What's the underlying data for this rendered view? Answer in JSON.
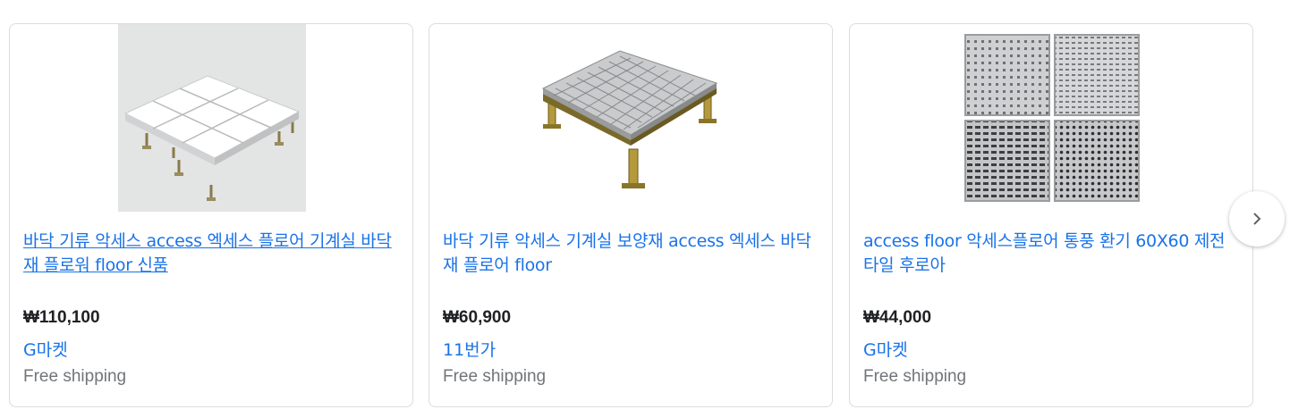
{
  "products": [
    {
      "title": "바닥 기류 악세스 access 엑세스 플로어 기계실 바닥재 플로워 floor 신품",
      "price": "₩110,100",
      "seller": "G마켓",
      "shipping": "Free shipping"
    },
    {
      "title": "바닥 기류 악세스 기계실 보양재 access 엑세스 바닥재 플로어 floor",
      "price": "₩60,900",
      "seller": "11번가",
      "shipping": "Free shipping"
    },
    {
      "title": "access floor 악세스플로어 통풍 환기 60X60 제전 타일 후로아",
      "price": "₩44,000",
      "seller": "G마켓",
      "shipping": "Free shipping"
    }
  ],
  "colors": {
    "link": "#1a73e8",
    "price": "#202124",
    "muted": "#70757a",
    "border": "#dadce0"
  },
  "icons": {
    "next": "chevron-right-icon"
  }
}
